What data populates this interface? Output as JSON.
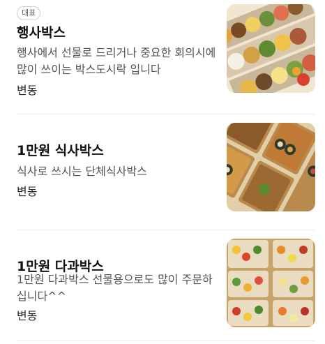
{
  "menu": {
    "items": [
      {
        "badge": "대표",
        "name": "행사박스",
        "description": "행사에서 선물로 드리거나 중요한 회의시에 많이 쓰이는 박스도시락 입니다",
        "price": "변동",
        "image": "event-lunchbox-photo"
      },
      {
        "name": "1만원 식사박스",
        "description": "식사로 쓰시는 단체식사박스",
        "price": "변동",
        "image": "meal-box-photo"
      },
      {
        "name": "1만원 다과박스",
        "description": "1만원 다과박스 선물용으로도 많이 주문하십니다^^",
        "price": "변동",
        "image": "snack-box-photo"
      }
    ]
  }
}
